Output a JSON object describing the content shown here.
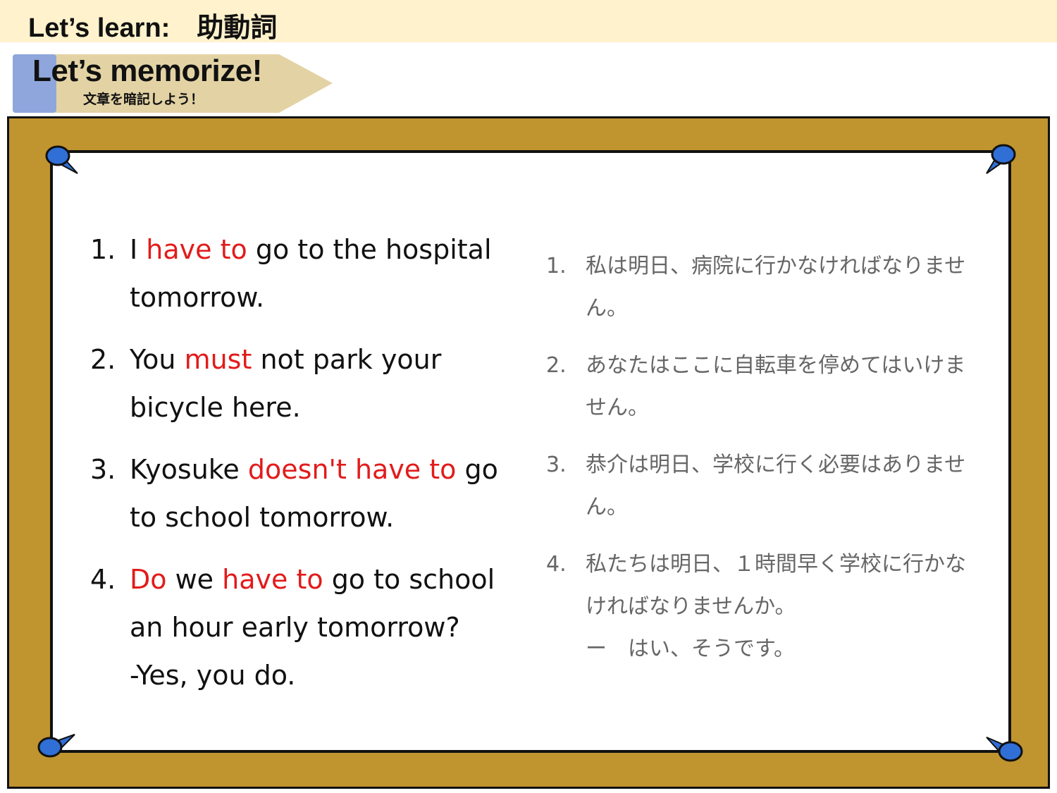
{
  "header": {
    "title": "Let’s learn:　助動詞"
  },
  "banner": {
    "title": "Let’s memorize!",
    "subtitle": "文章を暗記しよう！"
  },
  "english": [
    {
      "num": "1.",
      "parts": [
        "I ",
        "have to",
        " go to the hospital tomorrow."
      ]
    },
    {
      "num": "2.",
      "parts": [
        "You ",
        "must",
        " not park your bicycle here."
      ]
    },
    {
      "num": "3.",
      "parts": [
        "Kyosuke ",
        "doesn't have to",
        " go to school tomorrow."
      ]
    },
    {
      "num": "4.",
      "parts": [
        "",
        "Do",
        " we ",
        "have to",
        " go to school an hour early tomorrow?"
      ],
      "answer": "-Yes, you do."
    }
  ],
  "japanese": [
    {
      "num": "1.",
      "text": "私は明日、病院に行かなければなりません。"
    },
    {
      "num": "2.",
      "text": "あなたはここに自転車を停めてはいけません。"
    },
    {
      "num": "3.",
      "text": "恭介は明日、学校に行く必要はありません。"
    },
    {
      "num": "4.",
      "text": "私たちは明日、１時間早く学校に行かなければなりませんか。",
      "answer": "ー　はい、そうです。"
    }
  ],
  "colors": {
    "header_bg": "#fff2cc",
    "board": "#c0942f",
    "highlight": "#e21b1b",
    "pin": "#2f6fd6",
    "banner_tab": "#8fa6dc",
    "banner_body": "#e3d3a4"
  }
}
